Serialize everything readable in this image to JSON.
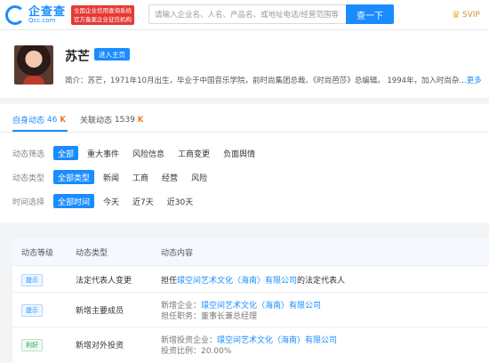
{
  "header": {
    "logo_cn": "企查查",
    "logo_en": "Qcc.com",
    "badge_line1": "全国企业信用查询系统",
    "badge_line2": "官方备案企业征信机构",
    "search_placeholder": "请输入企业名、人名、产品名、或地址电话/经营范围等",
    "search_button": "查一下",
    "svip_label": "SVIP"
  },
  "profile": {
    "name": "苏芒",
    "home_button": "进入主页",
    "intro": "简介：苏芒，1971年10月出生，毕业于中国音乐学院，前时尚集团总裁、《时尚芭莎》总编辑。 1994年，加入时尚杂...",
    "more": "更多"
  },
  "tabs": [
    {
      "label": "自身动态",
      "count": "46",
      "active": true
    },
    {
      "label": "关联动态",
      "count": "1539",
      "active": false
    }
  ],
  "filters": {
    "scope": {
      "label": "动态筛选",
      "options": [
        "全部",
        "重大事件",
        "风险信息",
        "工商变更",
        "负面舆情"
      ]
    },
    "type": {
      "label": "动态类型",
      "options": [
        "全部类型",
        "新闻",
        "工商",
        "经营",
        "风险"
      ]
    },
    "time": {
      "label": "时间选择",
      "options": [
        "全部时间",
        "今天",
        "近7天",
        "近30天"
      ]
    }
  },
  "table": {
    "headers": [
      "动态等级",
      "动态类型",
      "动态内容"
    ],
    "rows": [
      {
        "level": "提示",
        "type": "法定代表人变更",
        "line1_pre": "担任",
        "line1_link": "璟空间艺术文化（海南）有限公司",
        "line1_post": "的法定代表人"
      },
      {
        "level": "提示",
        "type": "新增主要成员",
        "line1_pre": "新增企业：",
        "line1_link": "璟空间艺术文化（海南）有限公司",
        "line2": "担任职务：董事长兼总经理"
      },
      {
        "level": "利好",
        "type": "新增对外投资",
        "line1_pre": "新增投资企业：",
        "line1_link": "璟空间艺术文化（海南）有限公司",
        "line2": "投资比例：20.00%"
      }
    ]
  },
  "colors": {
    "accent": "#1a8cff",
    "orange": "#f0771e"
  }
}
